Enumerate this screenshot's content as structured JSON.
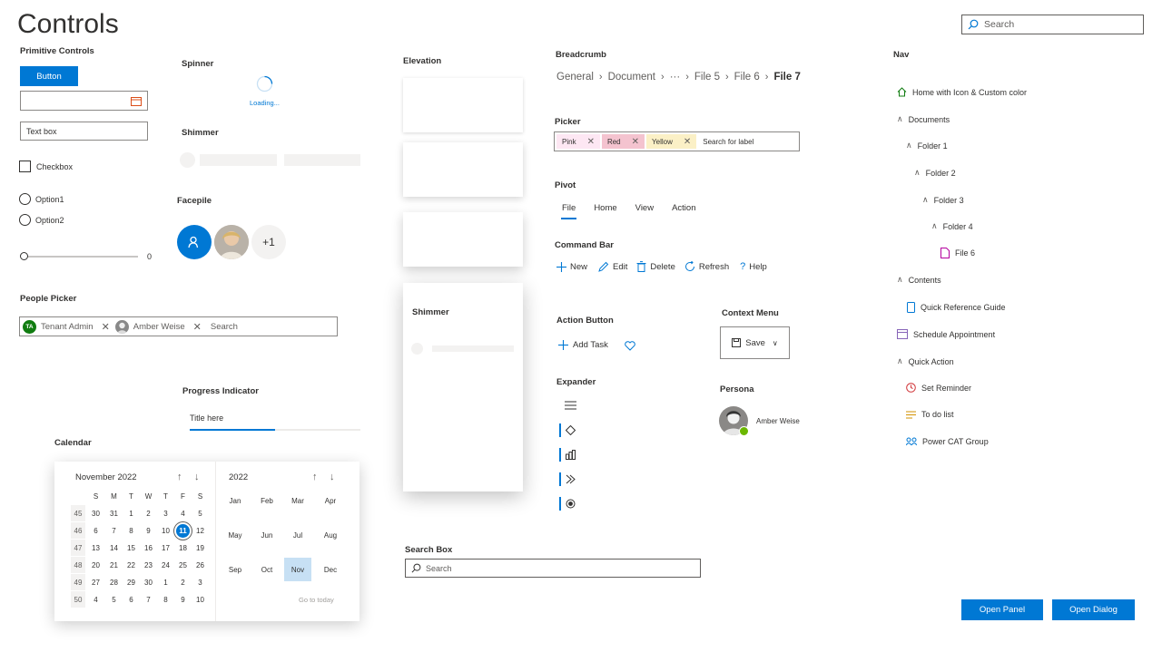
{
  "page": {
    "title": "Controls"
  },
  "search_top": {
    "placeholder": "Search"
  },
  "primitive": {
    "title": "Primitive Controls",
    "button_label": "Button",
    "textbox_value": "Text box",
    "checkbox_label": "Checkbox",
    "option1": "Option1",
    "option2": "Option2",
    "slider_value": "0"
  },
  "spinner": {
    "title": "Spinner",
    "label": "Loading..."
  },
  "shimmer": {
    "title": "Shimmer"
  },
  "facepile": {
    "title": "Facepile",
    "overflow": "+1"
  },
  "elevation": {
    "title": "Elevation",
    "shimmer_card_title": "Shimmer"
  },
  "breadcrumb": {
    "title": "Breadcrumb",
    "items": [
      "General",
      "Document",
      "···",
      "File 5",
      "File 6"
    ],
    "current": "File 7"
  },
  "picker": {
    "title": "Picker",
    "tags": [
      "Pink",
      "Red",
      "Yellow"
    ],
    "placeholder": "Search for label",
    "tag_colors": [
      "#fde7f3",
      "#f4c3cf",
      "#fbf0c6"
    ]
  },
  "pivot": {
    "title": "Pivot",
    "tabs": [
      "File",
      "Home",
      "View",
      "Action"
    ],
    "accent": "#0078d4"
  },
  "command_bar": {
    "title": "Command Bar",
    "items": [
      "New",
      "Edit",
      "Delete",
      "Refresh",
      "Help"
    ]
  },
  "action_button": {
    "title": "Action Button",
    "label": "Add Task"
  },
  "context_menu": {
    "title": "Context Menu",
    "label": "Save"
  },
  "expander": {
    "title": "Expander"
  },
  "persona": {
    "title": "Persona",
    "name": "Amber Weise"
  },
  "people_picker": {
    "title": "People Picker",
    "people": [
      "Tenant Admin",
      "Amber Weise"
    ],
    "initials": "TA",
    "placeholder": "Search"
  },
  "progress": {
    "title": "Progress Indicator",
    "label": "Title here",
    "percent": 0.5
  },
  "calendar": {
    "title": "Calendar",
    "month_label": "November 2022",
    "year_label": "2022",
    "dow": [
      "S",
      "M",
      "T",
      "W",
      "T",
      "F",
      "S"
    ],
    "weeks": [
      "45",
      "46",
      "47",
      "48",
      "49",
      "50"
    ],
    "days": [
      [
        "30",
        "31",
        "1",
        "2",
        "3",
        "4",
        "5"
      ],
      [
        "6",
        "7",
        "8",
        "9",
        "10",
        "11",
        "12"
      ],
      [
        "13",
        "14",
        "15",
        "16",
        "17",
        "18",
        "19"
      ],
      [
        "20",
        "21",
        "22",
        "23",
        "24",
        "25",
        "26"
      ],
      [
        "27",
        "28",
        "29",
        "30",
        "1",
        "2",
        "3"
      ],
      [
        "4",
        "5",
        "6",
        "7",
        "8",
        "9",
        "10"
      ]
    ],
    "selected_day": "11",
    "months": [
      "Jan",
      "Feb",
      "Mar",
      "Apr",
      "May",
      "Jun",
      "Jul",
      "Aug",
      "Sep",
      "Oct",
      "Nov",
      "Dec"
    ],
    "selected_month": "Nov",
    "goto_today": "Go to today"
  },
  "search_box": {
    "title": "Search Box",
    "placeholder": "Search"
  },
  "nav": {
    "title": "Nav",
    "items": [
      "Home with Icon & Custom color",
      "Documents",
      "Folder 1",
      "Folder 2",
      "Folder 3",
      "Folder 4",
      "File 6",
      "Contents",
      "Quick Reference Guide",
      "Schedule Appointment",
      "Quick Action",
      "Set Reminder",
      "To do list",
      "Power CAT Group"
    ],
    "home_color": "#107c10"
  },
  "footer": {
    "open_panel": "Open Panel",
    "open_dialog": "Open Dialog"
  }
}
